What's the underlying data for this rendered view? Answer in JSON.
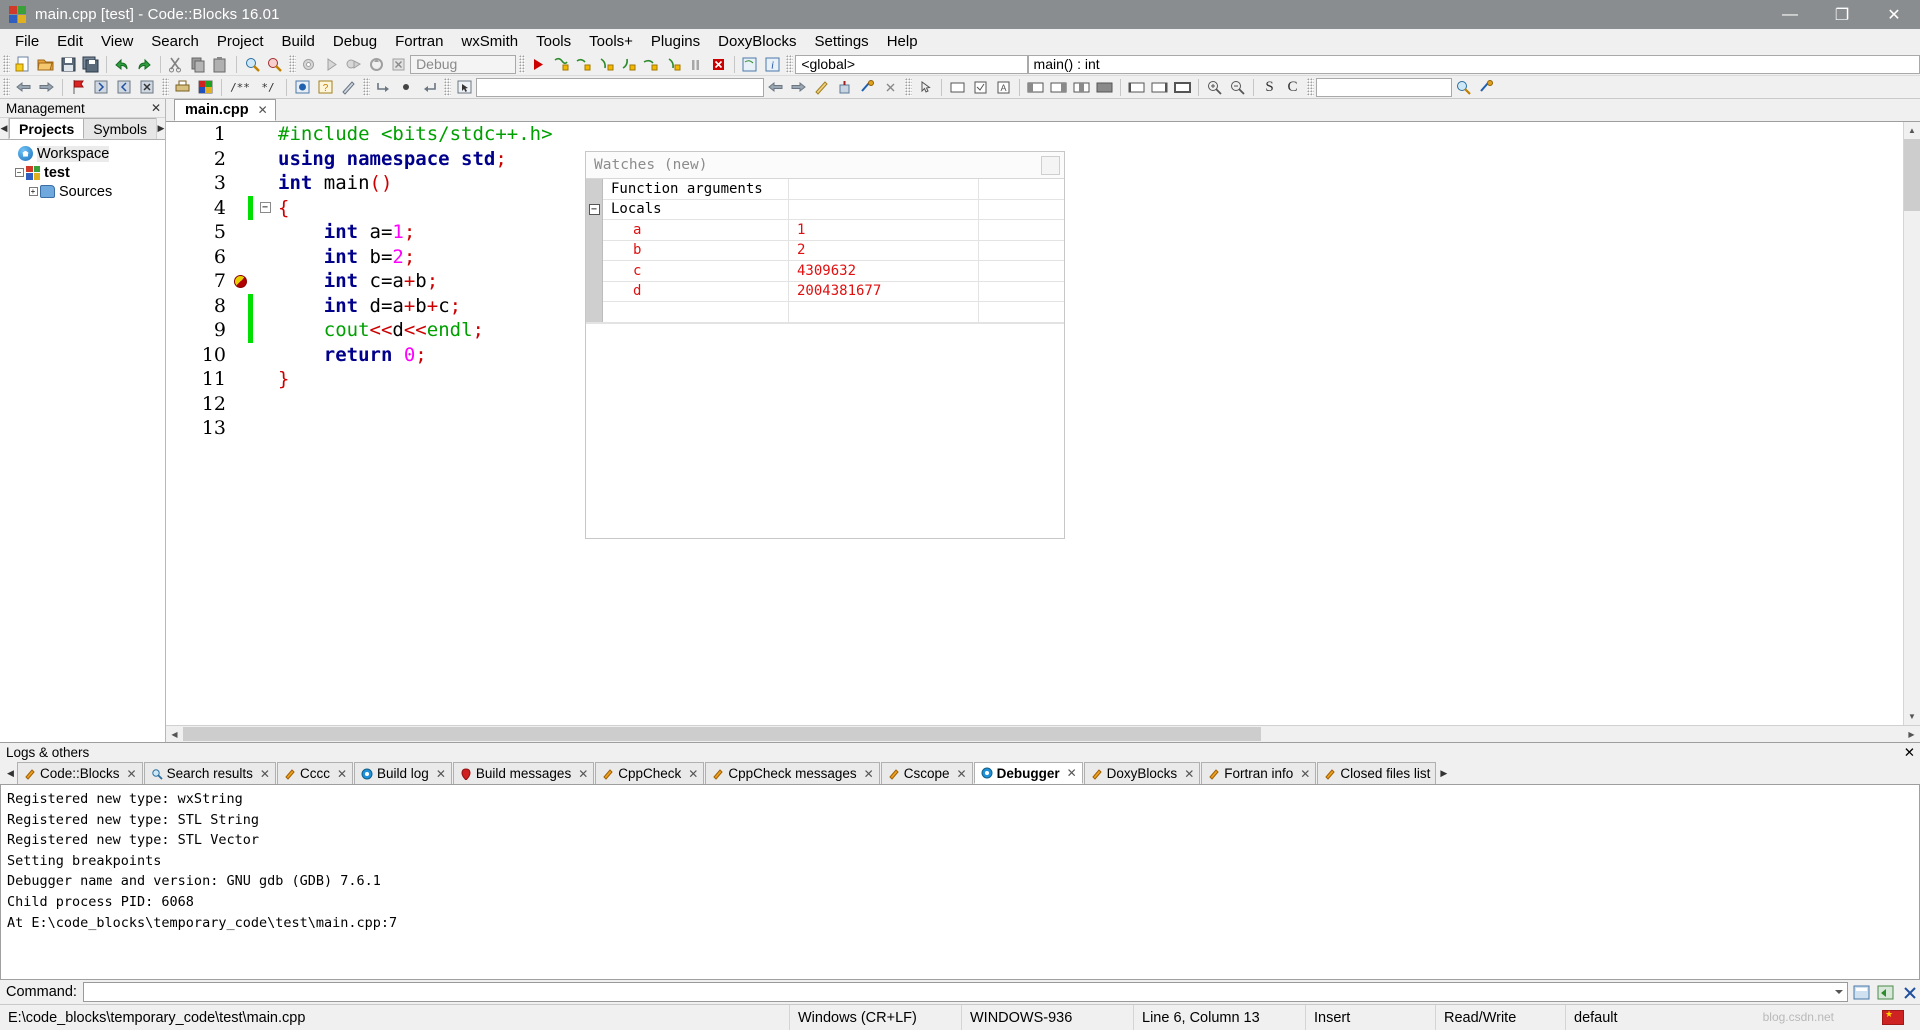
{
  "window": {
    "title": "main.cpp [test] - Code::Blocks 16.01",
    "minimize": "—",
    "maximize": "❐",
    "close": "✕"
  },
  "menu": {
    "items": [
      "File",
      "Edit",
      "View",
      "Search",
      "Project",
      "Build",
      "Debug",
      "Fortran",
      "wxSmith",
      "Tools",
      "Tools+",
      "Plugins",
      "DoxyBlocks",
      "Settings",
      "Help"
    ]
  },
  "toolbar": {
    "build_target": "Debug",
    "scope_global": "<global>",
    "scope_function": "main() : int",
    "search_value": ""
  },
  "management": {
    "header": "Management",
    "close": "✕",
    "tabs": [
      {
        "label": "Projects",
        "active": true
      },
      {
        "label": "Symbols",
        "active": false
      }
    ],
    "tree": [
      {
        "label": "Workspace",
        "icon": "workspace-icon",
        "level": 0
      },
      {
        "label": "test",
        "icon": "project-icon",
        "level": 1
      },
      {
        "label": "Sources",
        "icon": "folder-icon",
        "level": 2
      }
    ]
  },
  "editor": {
    "tab": {
      "label": "main.cpp",
      "close": "✕"
    },
    "lines": [
      {
        "n": "1",
        "breakpoint": false,
        "changed": false,
        "fold": "none",
        "tokens": [
          {
            "t": "#include <bits/stdc++.h>",
            "c": "pre"
          }
        ]
      },
      {
        "n": "2",
        "breakpoint": false,
        "changed": false,
        "fold": "none",
        "tokens": [
          {
            "t": "using namespace ",
            "c": "kw"
          },
          {
            "t": "std",
            "c": "kw"
          },
          {
            "t": ";",
            "c": "op"
          }
        ]
      },
      {
        "n": "3",
        "breakpoint": false,
        "changed": false,
        "fold": "none",
        "tokens": [
          {
            "t": "int ",
            "c": "kw"
          },
          {
            "t": "main",
            "c": "pl"
          },
          {
            "t": "()",
            "c": "op"
          }
        ]
      },
      {
        "n": "4",
        "breakpoint": false,
        "changed": true,
        "fold": "box",
        "tokens": [
          {
            "t": "{",
            "c": "op"
          }
        ]
      },
      {
        "n": "5",
        "breakpoint": false,
        "changed": false,
        "fold": "line",
        "tokens": [
          {
            "t": "    int ",
            "c": "kw"
          },
          {
            "t": "a=",
            "c": "pl"
          },
          {
            "t": "1",
            "c": "num"
          },
          {
            "t": ";",
            "c": "op"
          }
        ]
      },
      {
        "n": "6",
        "breakpoint": false,
        "changed": false,
        "fold": "line",
        "tokens": [
          {
            "t": "    int ",
            "c": "kw"
          },
          {
            "t": "b=",
            "c": "pl"
          },
          {
            "t": "2",
            "c": "num"
          },
          {
            "t": ";",
            "c": "op"
          }
        ]
      },
      {
        "n": "7",
        "breakpoint": true,
        "changed": false,
        "fold": "line",
        "tokens": [
          {
            "t": "    int ",
            "c": "kw"
          },
          {
            "t": "c=a",
            "c": "pl"
          },
          {
            "t": "+",
            "c": "op"
          },
          {
            "t": "b",
            "c": "pl"
          },
          {
            "t": ";",
            "c": "op"
          }
        ]
      },
      {
        "n": "8",
        "breakpoint": false,
        "changed": true,
        "fold": "line",
        "tokens": [
          {
            "t": "    int ",
            "c": "kw"
          },
          {
            "t": "d=a",
            "c": "pl"
          },
          {
            "t": "+",
            "c": "op"
          },
          {
            "t": "b",
            "c": "pl"
          },
          {
            "t": "+",
            "c": "op"
          },
          {
            "t": "c",
            "c": "pl"
          },
          {
            "t": ";",
            "c": "op"
          }
        ]
      },
      {
        "n": "9",
        "breakpoint": false,
        "changed": true,
        "fold": "line",
        "tokens": [
          {
            "t": "    cout",
            "c": "pre"
          },
          {
            "t": "<<",
            "c": "op"
          },
          {
            "t": "d",
            "c": "pl"
          },
          {
            "t": "<<",
            "c": "op"
          },
          {
            "t": "endl",
            "c": "pre"
          },
          {
            "t": ";",
            "c": "op"
          }
        ]
      },
      {
        "n": "10",
        "breakpoint": false,
        "changed": false,
        "fold": "line",
        "tokens": [
          {
            "t": "    return ",
            "c": "kw"
          },
          {
            "t": "0",
            "c": "num"
          },
          {
            "t": ";",
            "c": "op"
          }
        ]
      },
      {
        "n": "11",
        "breakpoint": false,
        "changed": false,
        "fold": "end",
        "tokens": [
          {
            "t": "}",
            "c": "op"
          }
        ]
      },
      {
        "n": "12",
        "breakpoint": false,
        "changed": false,
        "fold": "none",
        "tokens": [
          {
            "t": "",
            "c": "pl"
          }
        ]
      },
      {
        "n": "13",
        "breakpoint": false,
        "changed": false,
        "fold": "none",
        "tokens": [
          {
            "t": "",
            "c": "pl"
          }
        ]
      }
    ]
  },
  "watches": {
    "title": "Watches (new)",
    "rows": [
      {
        "expander": "",
        "name": "Function arguments",
        "value": "",
        "kind": "group"
      },
      {
        "expander": "−",
        "name": "Locals",
        "value": "",
        "kind": "group"
      },
      {
        "expander": "",
        "name": "a",
        "value": "1",
        "kind": "var"
      },
      {
        "expander": "",
        "name": "b",
        "value": "2",
        "kind": "var"
      },
      {
        "expander": "",
        "name": "c",
        "value": "4309632",
        "kind": "var"
      },
      {
        "expander": "",
        "name": "d",
        "value": "2004381677",
        "kind": "var"
      },
      {
        "expander": "",
        "name": "",
        "value": "",
        "kind": "empty"
      }
    ]
  },
  "logs": {
    "header": "Logs & others",
    "close": "✕",
    "tabs": [
      {
        "label": "Code::Blocks",
        "icon": "pencil-icon",
        "active": false,
        "closable": true
      },
      {
        "label": "Search results",
        "icon": "magnifier-icon",
        "active": false,
        "closable": true
      },
      {
        "label": "Cccc",
        "icon": "pencil-icon",
        "active": false,
        "closable": true
      },
      {
        "label": "Build log",
        "icon": "gear-blue-icon",
        "active": false,
        "closable": true
      },
      {
        "label": "Build messages",
        "icon": "pin-red-icon",
        "active": false,
        "closable": true
      },
      {
        "label": "CppCheck",
        "icon": "pencil-icon",
        "active": false,
        "closable": true
      },
      {
        "label": "CppCheck messages",
        "icon": "pencil-icon",
        "active": false,
        "closable": true
      },
      {
        "label": "Cscope",
        "icon": "pencil-icon",
        "active": false,
        "closable": true
      },
      {
        "label": "Debugger",
        "icon": "gear-blue-icon",
        "active": true,
        "closable": true
      },
      {
        "label": "DoxyBlocks",
        "icon": "pencil-icon",
        "active": false,
        "closable": true
      },
      {
        "label": "Fortran info",
        "icon": "pencil-icon",
        "active": false,
        "closable": true
      },
      {
        "label": "Closed files list",
        "icon": "pencil-icon",
        "active": false,
        "closable": false
      }
    ],
    "content": [
      "Registered new type: wxString",
      "Registered new type: STL String",
      "Registered new type: STL Vector",
      "Setting breakpoints",
      "Debugger name and version: GNU gdb (GDB) 7.6.1",
      "Child process PID: 6068",
      "At E:\\code_blocks\\temporary_code\\test\\main.cpp:7"
    ],
    "command_label": "Command:",
    "command_value": ""
  },
  "status": {
    "path": "E:\\code_blocks\\temporary_code\\test\\main.cpp",
    "eol": "Windows (CR+LF)",
    "encoding": "WINDOWS-936",
    "caret": "Line 6, Column 13",
    "insert": "Insert",
    "access": "Read/Write",
    "profile": "default",
    "watermark": "blog.csdn.net"
  }
}
